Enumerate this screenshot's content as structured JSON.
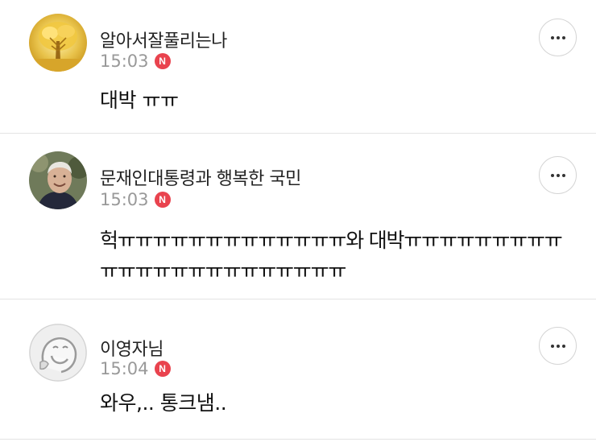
{
  "comments": [
    {
      "author": "알아서잘풀리는나",
      "time": "15:03",
      "badge": "N",
      "text": "대박 ㅠㅠ",
      "avatar": "golden-tree-avatar"
    },
    {
      "author": "문재인대통령과 행복한 국민",
      "time": "15:03",
      "badge": "N",
      "text": "헉ㅠㅠㅠㅠㅠㅠㅠㅠㅠㅠㅠㅠㅠ와 대박ㅠㅠㅠㅠㅠㅠㅠㅠㅠㅠㅠㅠㅠㅠㅠㅠㅠㅠㅠㅠㅠㅠㅠ",
      "avatar": "smiling-man-avatar"
    },
    {
      "author": "이영자님",
      "time": "15:04",
      "badge": "N",
      "text": "와우,.. 통크냄..",
      "avatar": "cartoon-face-avatar"
    }
  ],
  "icons": {
    "more": "more-horizontal-icon",
    "new": "new-badge-icon"
  },
  "colors": {
    "badge": "#e9434e",
    "time": "#999999",
    "divider": "#e3e3e3"
  }
}
